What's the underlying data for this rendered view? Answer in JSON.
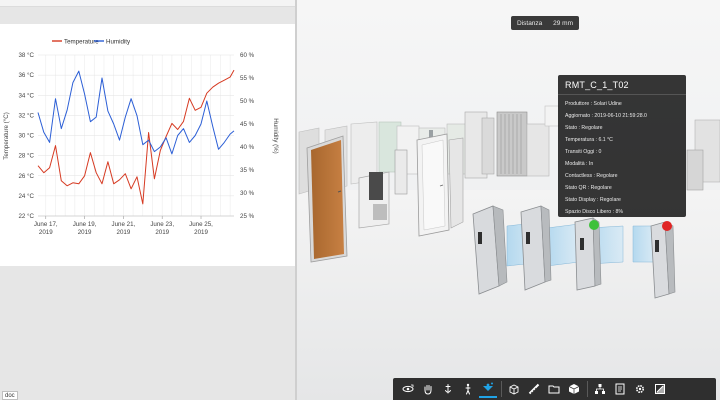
{
  "left_panel": {
    "doc_tag": "doc"
  },
  "chart_data": {
    "type": "line",
    "legend": [
      "Temperature",
      "Humidity"
    ],
    "legend_position": "top",
    "ylabel_left": "Temperature (°C)",
    "ylabel_right": "Humidity (%)",
    "y_left_ticks": [
      "38 °C",
      "36 °C",
      "34 °C",
      "32 °C",
      "30 °C",
      "28 °C",
      "26 °C",
      "24 °C",
      "22 °C"
    ],
    "y_right_ticks": [
      "60 %",
      "55 %",
      "50 %",
      "45 %",
      "40 %",
      "35 %",
      "30 %",
      "25 %"
    ],
    "x_ticks": [
      {
        "line1": "June 17,",
        "line2": "2019"
      },
      {
        "line1": "June 19,",
        "line2": "2019"
      },
      {
        "line1": "June 21,",
        "line2": "2019"
      },
      {
        "line1": "June 23,",
        "line2": "2019"
      },
      {
        "line1": "June 25,",
        "line2": "2019"
      }
    ],
    "ylim_left": [
      22,
      38
    ],
    "ylim_right": [
      25,
      60
    ],
    "x_range_days": [
      16.6,
      26.7
    ],
    "grid": true,
    "series": [
      {
        "name": "Temperature",
        "color": "#d63a22",
        "x": [
          16.6,
          16.9,
          17.2,
          17.5,
          17.8,
          18.1,
          18.4,
          18.7,
          19.0,
          19.3,
          19.6,
          19.9,
          20.2,
          20.5,
          20.8,
          21.1,
          21.4,
          21.7,
          22.0,
          22.3,
          22.6,
          22.9,
          23.2,
          23.5,
          23.8,
          24.1,
          24.4,
          24.7,
          25.0,
          25.3,
          25.6,
          25.9,
          26.2,
          26.5,
          26.7
        ],
        "y": [
          27.0,
          26.3,
          26.8,
          29.0,
          25.5,
          25.0,
          25.3,
          25.2,
          26.0,
          28.3,
          26.3,
          25.2,
          27.4,
          25.2,
          25.6,
          26.2,
          24.7,
          25.9,
          23.2,
          30.3,
          25.7,
          28.5,
          29.9,
          31.2,
          30.6,
          31.4,
          33.7,
          32.5,
          32.8,
          34.2,
          34.8,
          35.2,
          35.5,
          35.8,
          36.5
        ]
      },
      {
        "name": "Humidity",
        "color": "#2c5fd6",
        "x": [
          16.6,
          16.9,
          17.2,
          17.5,
          17.8,
          18.1,
          18.4,
          18.7,
          19.0,
          19.3,
          19.6,
          19.9,
          20.2,
          20.5,
          20.8,
          21.1,
          21.4,
          21.7,
          22.0,
          22.3,
          22.6,
          22.9,
          23.2,
          23.5,
          23.8,
          24.1,
          24.4,
          24.7,
          25.0,
          25.3,
          25.6,
          25.9,
          26.2,
          26.5,
          26.7
        ],
        "y": [
          47.5,
          43.2,
          41.0,
          50.5,
          44.0,
          48.0,
          54.0,
          56.5,
          51.5,
          45.5,
          46.5,
          55.0,
          47.8,
          45.0,
          41.5,
          46.5,
          50.5,
          46.8,
          40.5,
          41.5,
          39.0,
          40.0,
          42.0,
          38.5,
          42.5,
          44.0,
          41.0,
          42.5,
          45.0,
          50.0,
          44.5,
          39.5,
          41.0,
          42.8,
          43.5
        ]
      }
    ]
  },
  "viewer": {
    "distance": {
      "label": "Distanza",
      "value": "29 mm"
    },
    "info_panel": {
      "title": "RMT_C_1_T02",
      "rows": [
        "Produttore : Solari Udine",
        "Aggiornato : 2019-06-10 21:59:28.0",
        "Stato : Regolare",
        "Temperatura : 6.1 °C",
        "Transiti Oggi : 0",
        "Modalità : In",
        "Contactless : Regolare",
        "Stato QR : Regolare",
        "Stato Display : Regolare",
        "Spazio Disco Libero : 8%"
      ]
    },
    "toolbar": {
      "buttons": [
        {
          "name": "orbit-icon"
        },
        {
          "name": "pan-hand-icon"
        },
        {
          "name": "first-person-icon"
        },
        {
          "name": "walk-person-icon"
        },
        {
          "name": "explode-icon"
        },
        {
          "name": "section-box-icon"
        },
        {
          "name": "measure-icon"
        },
        {
          "name": "folder-icon"
        },
        {
          "name": "cube-icon"
        },
        {
          "name": "model-tree-icon"
        },
        {
          "name": "properties-icon"
        },
        {
          "name": "settings-gear-icon"
        },
        {
          "name": "fullscreen-icon"
        }
      ]
    },
    "status_colors": {
      "ok": "#3ec13a",
      "error": "#e02424"
    }
  }
}
